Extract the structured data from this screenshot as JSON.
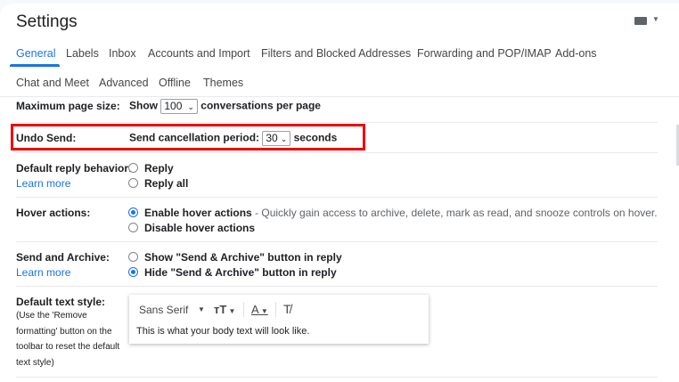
{
  "header": {
    "title": "Settings",
    "keyboard_icon": "keyboard-icon"
  },
  "tabs": [
    {
      "label": "General",
      "active": true
    },
    {
      "label": "Labels"
    },
    {
      "label": "Inbox"
    },
    {
      "label": "Accounts and Import"
    },
    {
      "label": "Filters and Blocked Addresses"
    },
    {
      "label": "Forwarding and POP/IMAP"
    },
    {
      "label": "Add-ons"
    },
    {
      "label": "Chat and Meet"
    },
    {
      "label": "Advanced"
    },
    {
      "label": "Offline"
    },
    {
      "label": "Themes"
    }
  ],
  "page_size": {
    "label": "Maximum page size:",
    "prefix": "Show",
    "value": "100",
    "suffix": "conversations per page"
  },
  "undo_send": {
    "label": "Undo Send:",
    "prefix": "Send cancellation period:",
    "value": "30",
    "suffix": "seconds",
    "highlight_color": "#ee0000"
  },
  "reply": {
    "label": "Default reply behavior:",
    "learn_more": "Learn more",
    "options": [
      "Reply",
      "Reply all"
    ]
  },
  "hover": {
    "label": "Hover actions:",
    "options": [
      "Enable hover actions",
      "Disable hover actions"
    ],
    "description": " - Quickly gain access to archive, delete, mark as read, and snooze controls on hover."
  },
  "send_archive": {
    "label": "Send and Archive:",
    "learn_more": "Learn more",
    "options": [
      "Show \"Send & Archive\" button in reply",
      "Hide \"Send & Archive\" button in reply"
    ]
  },
  "text_style": {
    "label": "Default text style:",
    "note": "(Use the 'Remove formatting' button on the toolbar to reset the default text style)",
    "font": "Sans Serif",
    "preview": "This is what your body text will look like."
  }
}
